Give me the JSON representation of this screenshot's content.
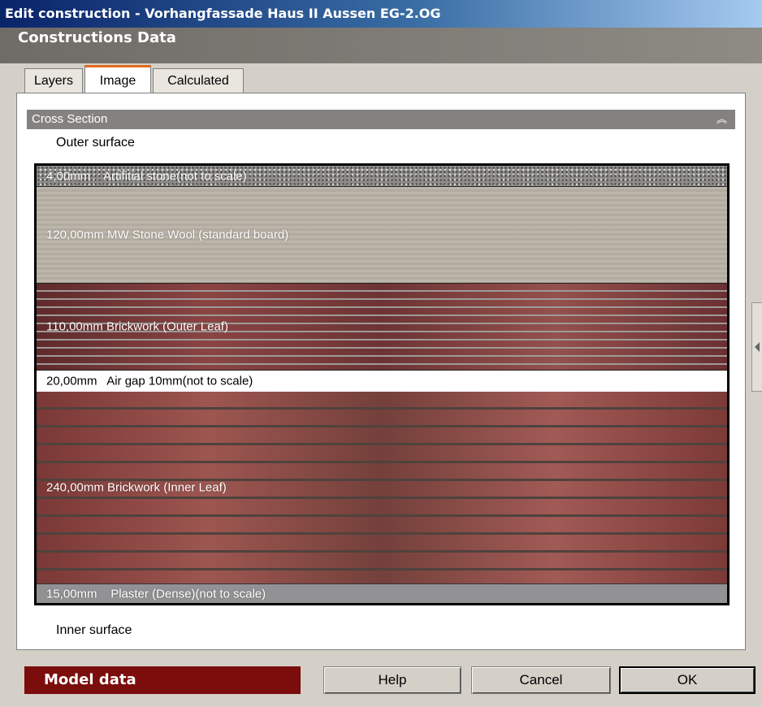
{
  "window": {
    "title": "Edit construction - Vorhangfassade Haus II Aussen EG-2.OG"
  },
  "header": {
    "title": "Constructions Data"
  },
  "tabs": [
    {
      "label": "Layers",
      "active": false
    },
    {
      "label": "Image",
      "active": true
    },
    {
      "label": "Calculated",
      "active": false
    }
  ],
  "cross_section": {
    "heading": "Cross Section",
    "collapse_icon": "double-chevron-up-icon",
    "outer_surface": "Outer surface",
    "inner_surface": "Inner surface",
    "layers": [
      {
        "thickness": "4,00mm",
        "material": "Artifitial stone(not to scale)"
      },
      {
        "thickness": "120,00mm",
        "material": "MW Stone Wool (standard board)"
      },
      {
        "thickness": "110,00mm",
        "material": "Brickwork (Outer Leaf)"
      },
      {
        "thickness": "20,00mm",
        "material": "Air gap 10mm(not to scale)"
      },
      {
        "thickness": "240,00mm",
        "material": "Brickwork (Inner Leaf)"
      },
      {
        "thickness": "15,00mm",
        "material": "Plaster (Dense)(not to scale)"
      }
    ]
  },
  "footer": {
    "model_data": "Model data",
    "help": "Help",
    "cancel": "Cancel",
    "ok": "OK"
  },
  "colors": {
    "model_data_bg": "#7b0d0d",
    "active_tab_accent": "#e06a1c"
  }
}
